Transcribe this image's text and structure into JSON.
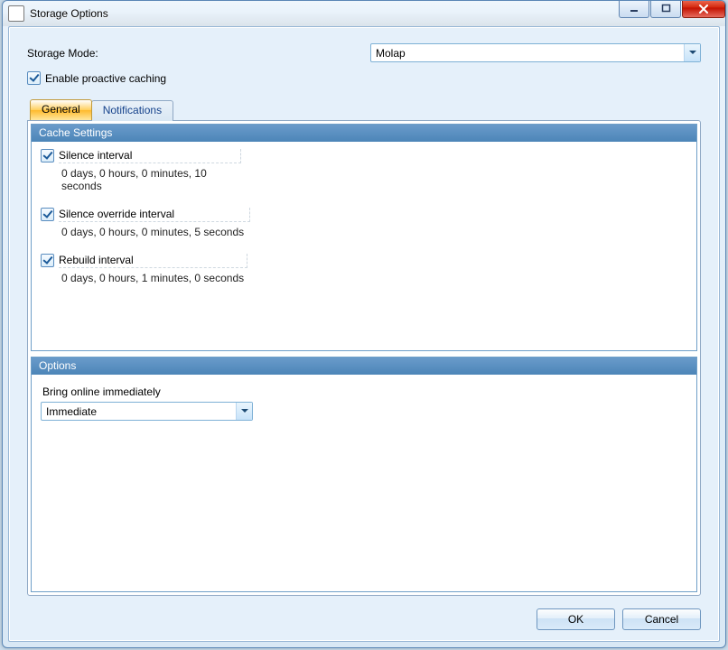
{
  "window": {
    "title": "Storage Options"
  },
  "winControls": {
    "min": "0",
    "max": "1",
    "close": "r"
  },
  "storageMode": {
    "label": "Storage Mode:",
    "value": "Molap"
  },
  "enableCaching": {
    "label": "Enable proactive caching",
    "checked": true
  },
  "tabs": {
    "general": "General",
    "notifications": "Notifications"
  },
  "groups": {
    "cache": "Cache Settings",
    "options": "Options"
  },
  "cache": {
    "silence": {
      "label": "Silence interval",
      "value": "0 days, 0 hours, 0 minutes, 10 seconds"
    },
    "override": {
      "label": "Silence override interval",
      "value": "0 days, 0 hours, 0 minutes, 5 seconds"
    },
    "rebuild": {
      "label": "Rebuild interval",
      "value": "0 days, 0 hours, 1 minutes, 0 seconds"
    }
  },
  "options": {
    "bringOnlineLabel": "Bring online immediately",
    "bringOnlineValue": "Immediate"
  },
  "buttons": {
    "ok": "OK",
    "cancel": "Cancel"
  }
}
